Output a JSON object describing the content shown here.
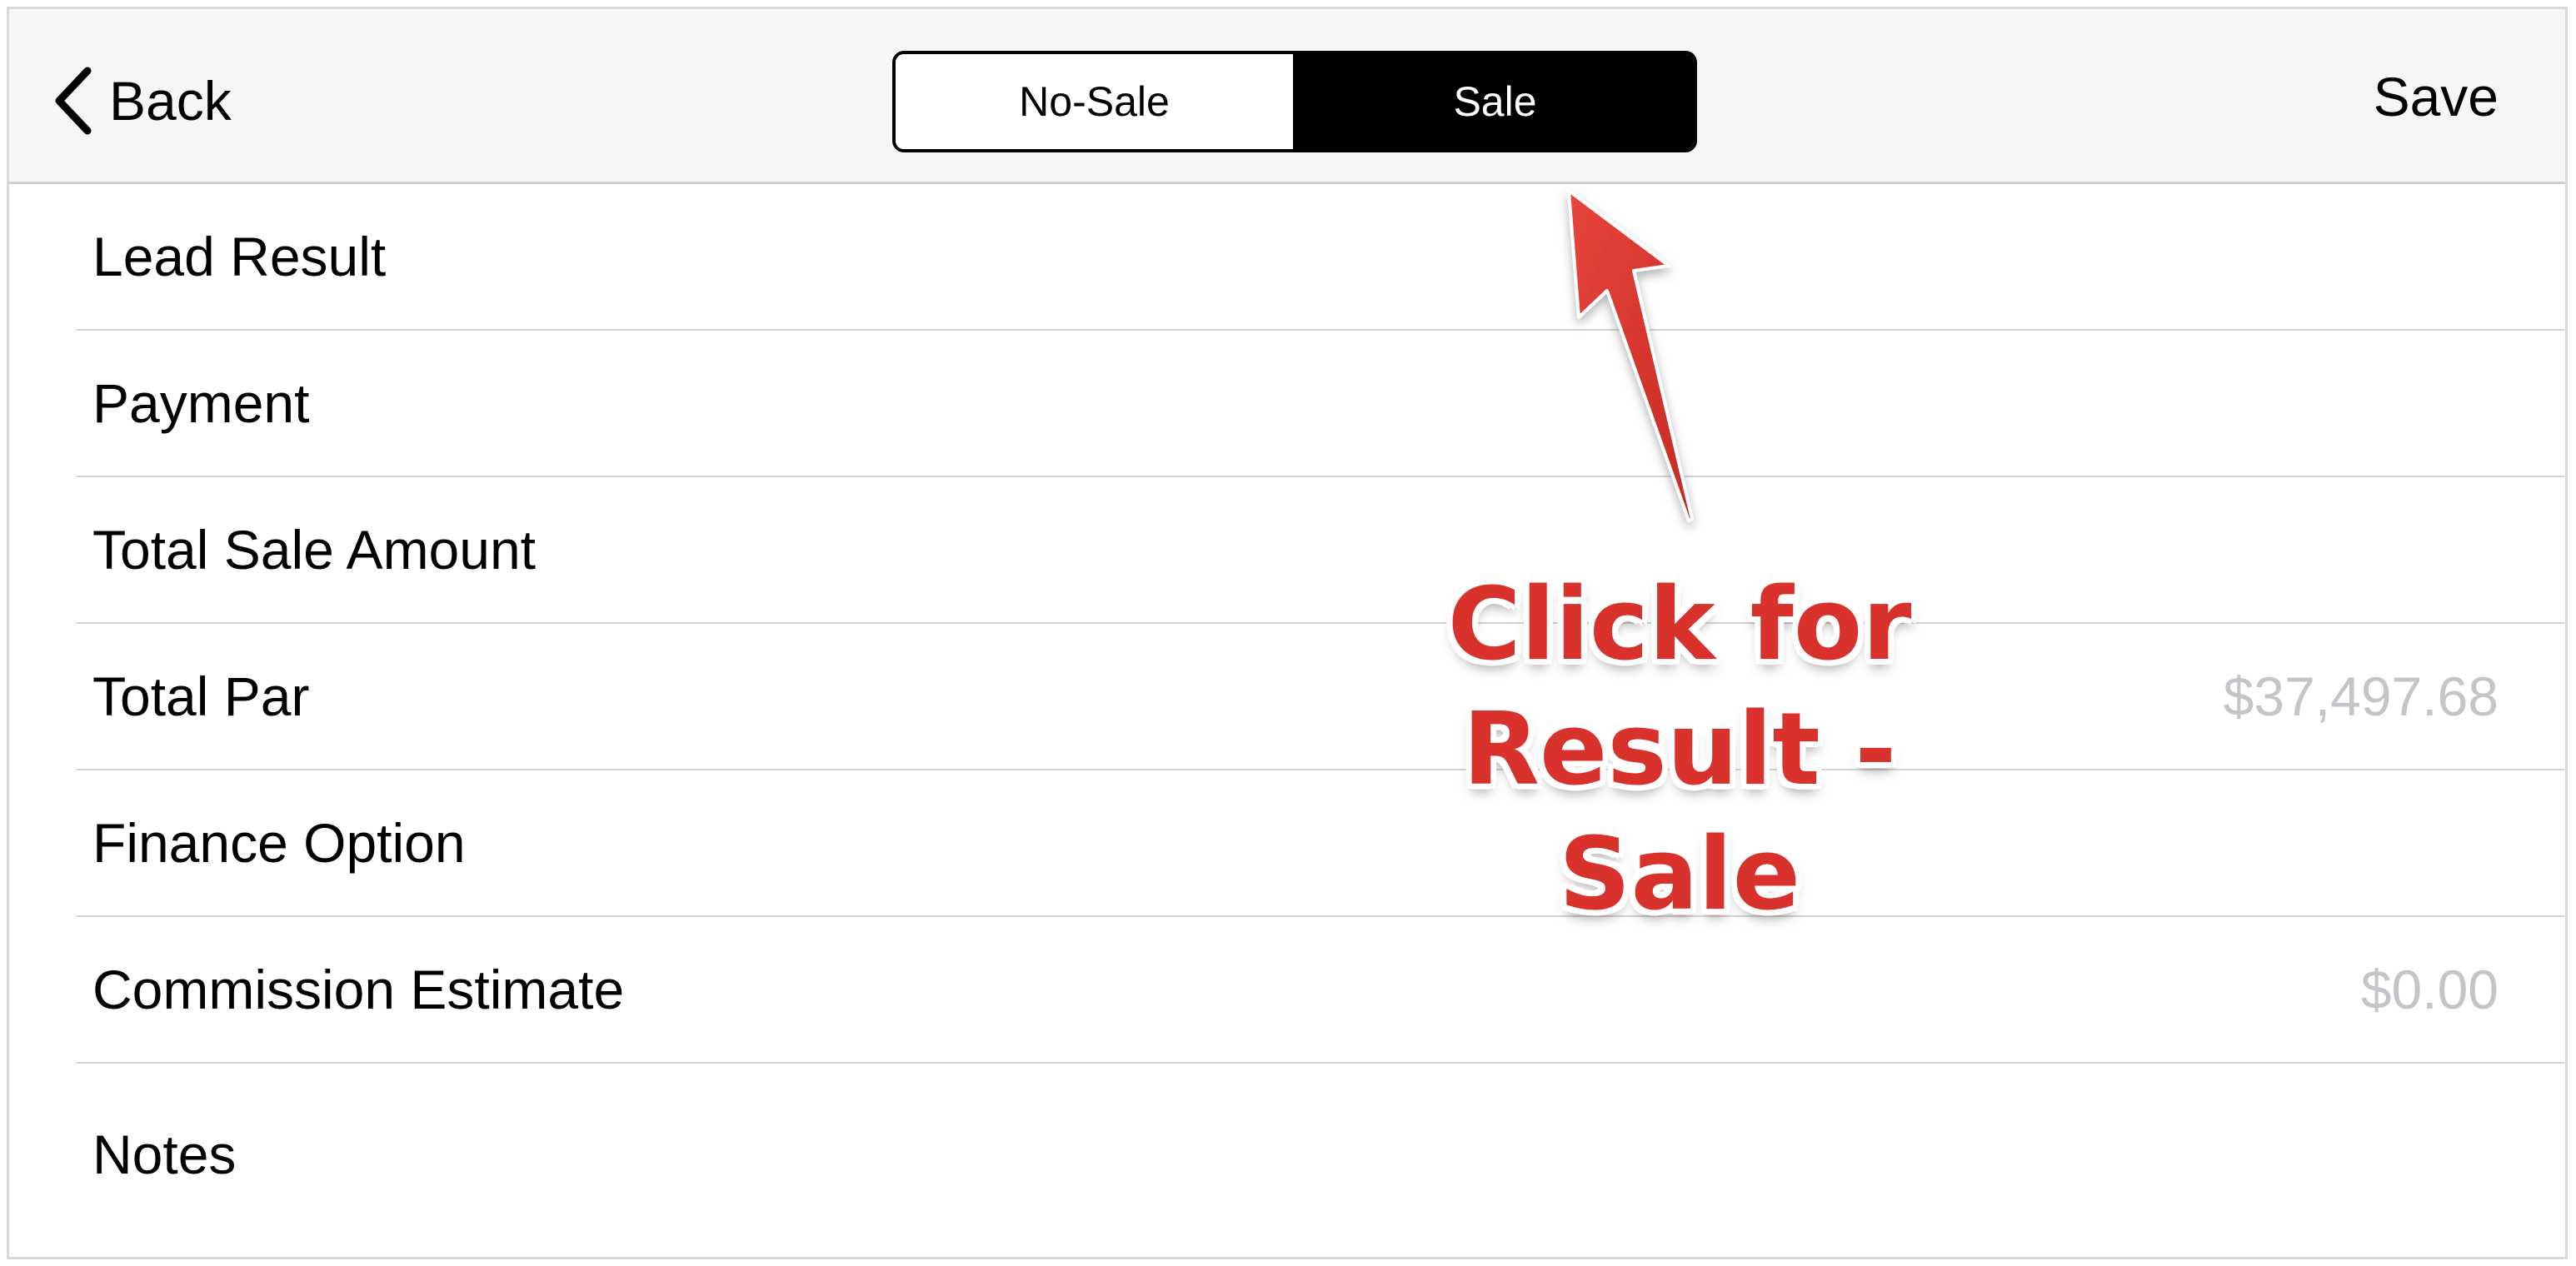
{
  "navbar": {
    "back_label": "Back",
    "save_label": "Save",
    "segments": [
      {
        "label": "No-Sale",
        "selected": false
      },
      {
        "label": "Sale",
        "selected": true
      }
    ]
  },
  "rows": [
    {
      "label": "Lead Result",
      "value": ""
    },
    {
      "label": "Payment",
      "value": ""
    },
    {
      "label": "Total Sale Amount",
      "value": ""
    },
    {
      "label": "Total Par",
      "value": "$37,497.68"
    },
    {
      "label": "Finance Option",
      "value": ""
    },
    {
      "label": "Commission Estimate",
      "value": "$0.00"
    },
    {
      "label": "Notes",
      "value": ""
    }
  ],
  "annotation": {
    "line1": "Click for",
    "line2": "Result - Sale",
    "color": "#d9312b"
  },
  "colors": {
    "selected_segment_bg": "#000000",
    "placeholder_value": "#c4c4c9"
  },
  "icons": {
    "back": "chevron-left-icon"
  }
}
